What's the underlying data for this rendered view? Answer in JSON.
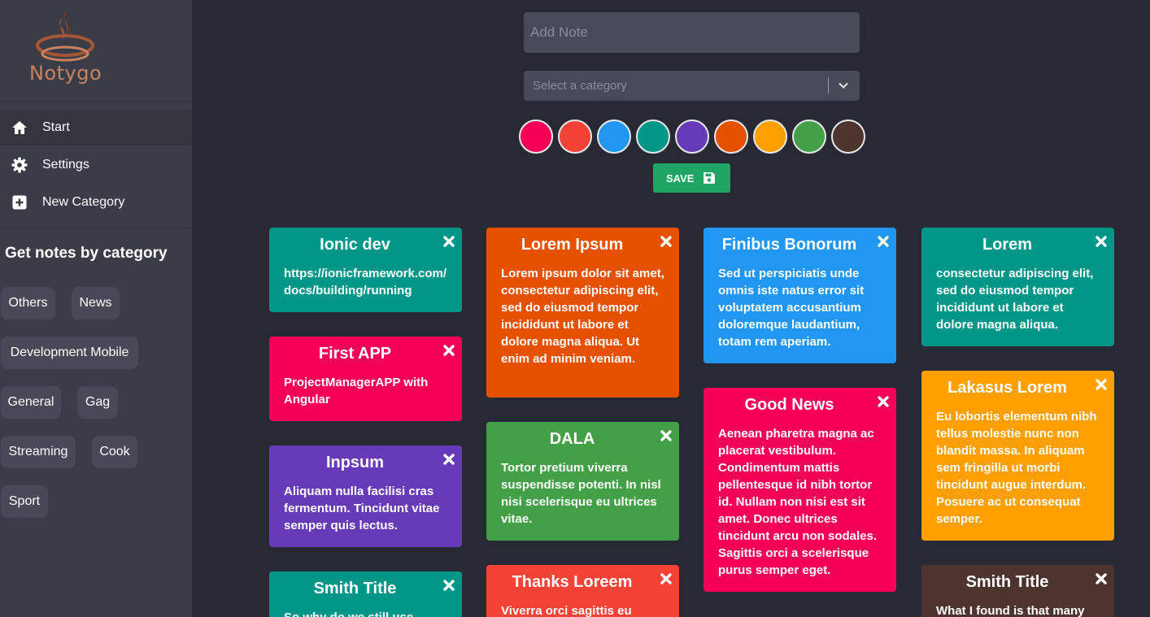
{
  "app": {
    "name": "Notygo"
  },
  "sidebar": {
    "nav": [
      {
        "label": "Start",
        "icon": "home-icon"
      },
      {
        "label": "Settings",
        "icon": "gear-icon"
      },
      {
        "label": "New Category",
        "icon": "plus-square-icon"
      }
    ],
    "categories_title": "Get notes by category",
    "categories": [
      "Others",
      "News",
      "Development Mobile",
      "General",
      "Gag",
      "Streaming",
      "Cook",
      "Sport"
    ]
  },
  "form": {
    "note_placeholder": "Add Note",
    "category_placeholder": "Select a category",
    "colors": [
      "#f50057",
      "#f44336",
      "#2196f3",
      "#009688",
      "#673ab7",
      "#e65100",
      "#ffa000",
      "#43a047",
      "#4e342e"
    ],
    "save_label": "SAVE"
  },
  "notes": [
    {
      "title": "Ionic dev",
      "body": "https://ionicframework.com/docs/building/running",
      "color": "#009688"
    },
    {
      "title": "First APP",
      "body": "ProjectManagerAPP with Angular",
      "color": "#f50057"
    },
    {
      "title": "Inpsum",
      "body": "Aliquam nulla facilisi cras fermentum. Tincidunt vitae semper quis lectus.",
      "color": "#673ab7"
    },
    {
      "title": "Smith Title",
      "body": "So why do we still use",
      "color": "#009688"
    },
    {
      "title": "Lorem Ipsum",
      "body": "Lorem ipsum dolor sit amet, consectetur adipiscing elit, sed do eiusmod tempor incididunt ut labore et dolore magna aliqua. Ut enim ad minim veniam.",
      "color": "#e65100"
    },
    {
      "title": "DALA",
      "body": "Tortor pretium viverra suspendisse potenti. In nisl nisi scelerisque eu ultrices vitae.",
      "color": "#43a047"
    },
    {
      "title": "Thanks Loreem",
      "body": "Viverra orci sagittis eu",
      "color": "#f44336"
    },
    {
      "title": "Finibus Bonorum",
      "body": "Sed ut perspiciatis unde omnis iste natus error sit voluptatem accusantium doloremque laudantium, totam rem aperiam.",
      "color": "#2196f3"
    },
    {
      "title": "Good News",
      "body": "Aenean pharetra magna ac placerat vestibulum. Condimentum mattis pellentesque id nibh tortor id. Nullam non nisi est sit amet. Donec ultrices tincidunt arcu non sodales. Sagittis orci a scelerisque purus semper eget.",
      "color": "#f50057"
    },
    {
      "title": "Lorem",
      "body": "consectetur adipiscing elit, sed do eiusmod tempor incididunt ut labore et dolore magna aliqua.",
      "color": "#009688"
    },
    {
      "title": "Lakasus Lorem",
      "body": "Eu lobortis elementum nibh tellus molestie nunc non blandit massa. In aliquam sem fringilla ut morbi tincidunt augue interdum. Posuere ac ut consequat semper.",
      "color": "#ffa000"
    },
    {
      "title": "Smith Title",
      "body": "What I found is that many",
      "color": "#4e342e"
    }
  ]
}
